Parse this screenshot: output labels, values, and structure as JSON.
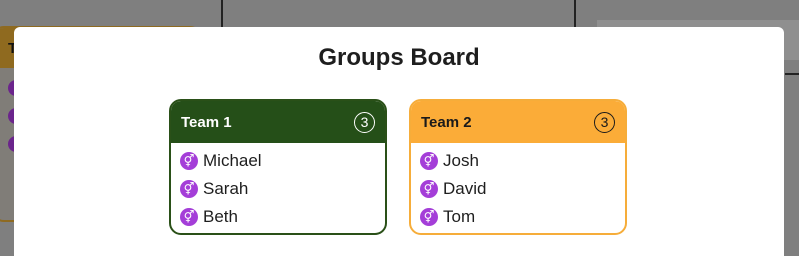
{
  "background": {
    "card_title": "T"
  },
  "modal": {
    "title": "Groups Board"
  },
  "groups": [
    {
      "name": "Team 1",
      "count": "3",
      "color": "#254f18",
      "members": [
        {
          "name": "Michael",
          "icon": "person-gender-icon"
        },
        {
          "name": "Sarah",
          "icon": "person-gender-icon"
        },
        {
          "name": "Beth",
          "icon": "person-gender-icon"
        }
      ]
    },
    {
      "name": "Team 2",
      "count": "3",
      "color": "#fbac38",
      "members": [
        {
          "name": "Josh",
          "icon": "person-gender-icon"
        },
        {
          "name": "David",
          "icon": "person-gender-icon"
        },
        {
          "name": "Tom",
          "icon": "person-gender-icon"
        }
      ]
    }
  ],
  "member_icon_glyph": "⚥",
  "colors": {
    "member_icon": "#a43ed8",
    "overlay": "#7f7f7f"
  }
}
